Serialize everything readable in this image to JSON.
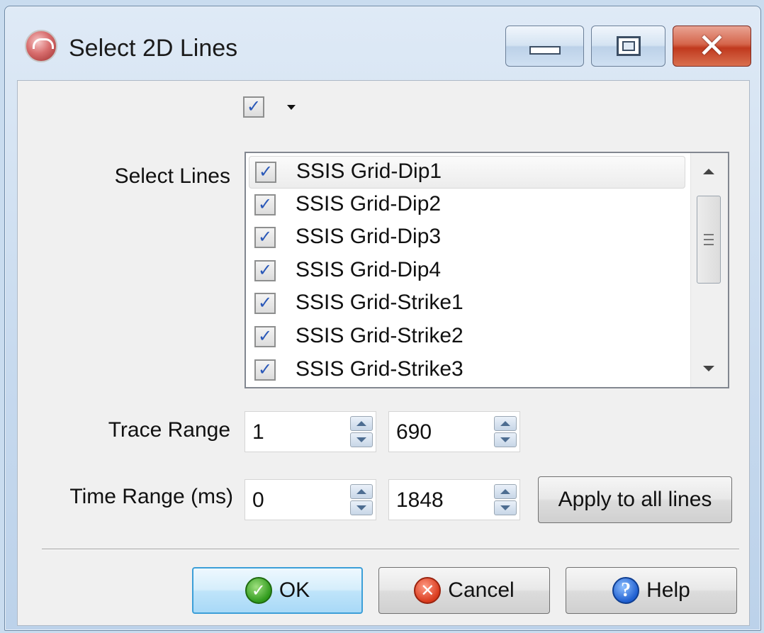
{
  "window": {
    "title": "Select 2D Lines"
  },
  "top_checkbox": {
    "checked": true,
    "check_glyph": "✓"
  },
  "labels": {
    "select_lines": "Select Lines",
    "trace_range": "Trace Range",
    "time_range": "Time Range (ms)"
  },
  "lines": [
    {
      "label": "SSIS Grid-Dip1",
      "checked": true
    },
    {
      "label": "SSIS Grid-Dip2",
      "checked": true
    },
    {
      "label": "SSIS Grid-Dip3",
      "checked": true
    },
    {
      "label": "SSIS Grid-Dip4",
      "checked": true
    },
    {
      "label": "SSIS Grid-Strike1",
      "checked": true
    },
    {
      "label": "SSIS Grid-Strike2",
      "checked": true
    },
    {
      "label": "SSIS Grid-Strike3",
      "checked": true
    }
  ],
  "trace_range": {
    "from": "1",
    "to": "690"
  },
  "time_range": {
    "from": "0",
    "to": "1848"
  },
  "buttons": {
    "apply_all": "Apply to all lines",
    "ok": "OK",
    "cancel": "Cancel",
    "help": "Help"
  },
  "icons": {
    "app": "app-icon",
    "ok": "check-icon",
    "cancel": "x-icon",
    "help": "question-icon"
  },
  "colors": {
    "titlebar": "#c6d9ee",
    "close_button": "#c0391e",
    "ok_focus_border": "#3c9fd8",
    "check": "#2a58b8"
  }
}
